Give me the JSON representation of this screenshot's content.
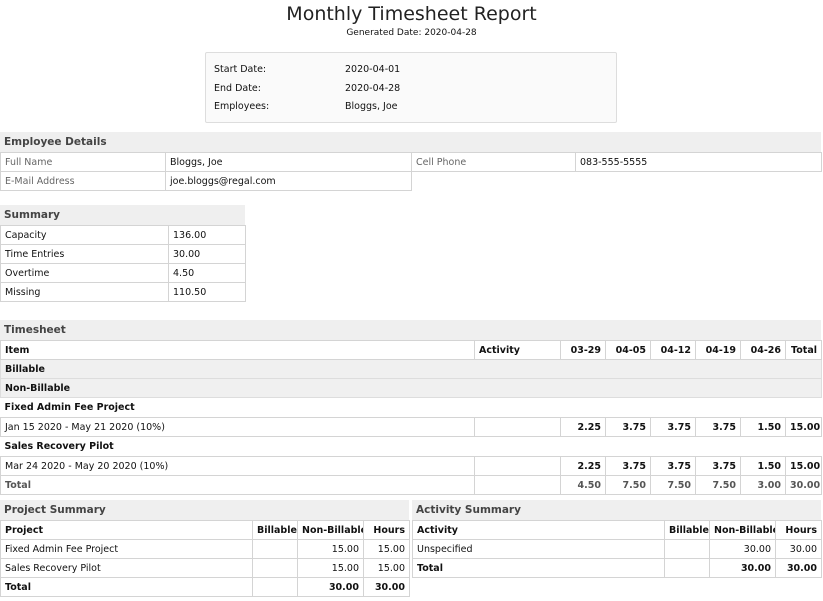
{
  "header": {
    "title": "Monthly Timesheet Report",
    "generated_label": "Generated Date:",
    "generated_value": "2020-04-28"
  },
  "info": {
    "start_label": "Start Date:",
    "start_value": "2020-04-01",
    "end_label": "End Date:",
    "end_value": "2020-04-28",
    "employees_label": "Employees:",
    "employees_value": "Bloggs, Joe"
  },
  "employee": {
    "heading": "Employee Details",
    "full_name_label": "Full Name",
    "full_name": "Bloggs, Joe",
    "cell_label": "Cell Phone",
    "cell": "083-555-5555",
    "email_label": "E-Mail Address",
    "email": "joe.bloggs@regal.com"
  },
  "summary": {
    "heading": "Summary",
    "rows": [
      {
        "label": "Capacity",
        "value": "136.00"
      },
      {
        "label": "Time Entries",
        "value": "30.00"
      },
      {
        "label": "Overtime",
        "value": "4.50"
      },
      {
        "label": "Missing",
        "value": "110.50"
      }
    ]
  },
  "timesheet": {
    "heading": "Timesheet",
    "cols": {
      "item": "Item",
      "activity": "Activity",
      "w1": "03-29",
      "w2": "04-05",
      "w3": "04-12",
      "w4": "04-19",
      "w5": "04-26",
      "total": "Total"
    },
    "billable": "Billable",
    "non_billable": "Non-Billable",
    "projects": [
      {
        "name": "Fixed Admin Fee Project",
        "line": "Jan 15 2020 - May 21 2020 (10%)",
        "v": [
          "2.25",
          "3.75",
          "3.75",
          "3.75",
          "1.50",
          "15.00"
        ]
      },
      {
        "name": "Sales Recovery Pilot",
        "line": "Mar 24 2020 - May 20 2020 (10%)",
        "v": [
          "2.25",
          "3.75",
          "3.75",
          "3.75",
          "1.50",
          "15.00"
        ]
      }
    ],
    "total_label": "Total",
    "totals": [
      "4.50",
      "7.50",
      "7.50",
      "7.50",
      "3.00",
      "30.00"
    ]
  },
  "project_summary": {
    "heading": "Project Summary",
    "cols": {
      "name": "Project",
      "billable": "Billable",
      "non_billable": "Non-Billable",
      "hours": "Hours"
    },
    "rows": [
      {
        "name": "Fixed Admin Fee Project",
        "billable": "",
        "non_billable": "15.00",
        "hours": "15.00"
      },
      {
        "name": "Sales Recovery Pilot",
        "billable": "",
        "non_billable": "15.00",
        "hours": "15.00"
      }
    ],
    "total": {
      "name": "Total",
      "billable": "",
      "non_billable": "30.00",
      "hours": "30.00"
    }
  },
  "activity_summary": {
    "heading": "Activity Summary",
    "cols": {
      "name": "Activity",
      "billable": "Billable",
      "non_billable": "Non-Billable",
      "hours": "Hours"
    },
    "rows": [
      {
        "name": "Unspecified",
        "billable": "",
        "non_billable": "30.00",
        "hours": "30.00"
      }
    ],
    "total": {
      "name": "Total",
      "billable": "",
      "non_billable": "30.00",
      "hours": "30.00"
    }
  }
}
